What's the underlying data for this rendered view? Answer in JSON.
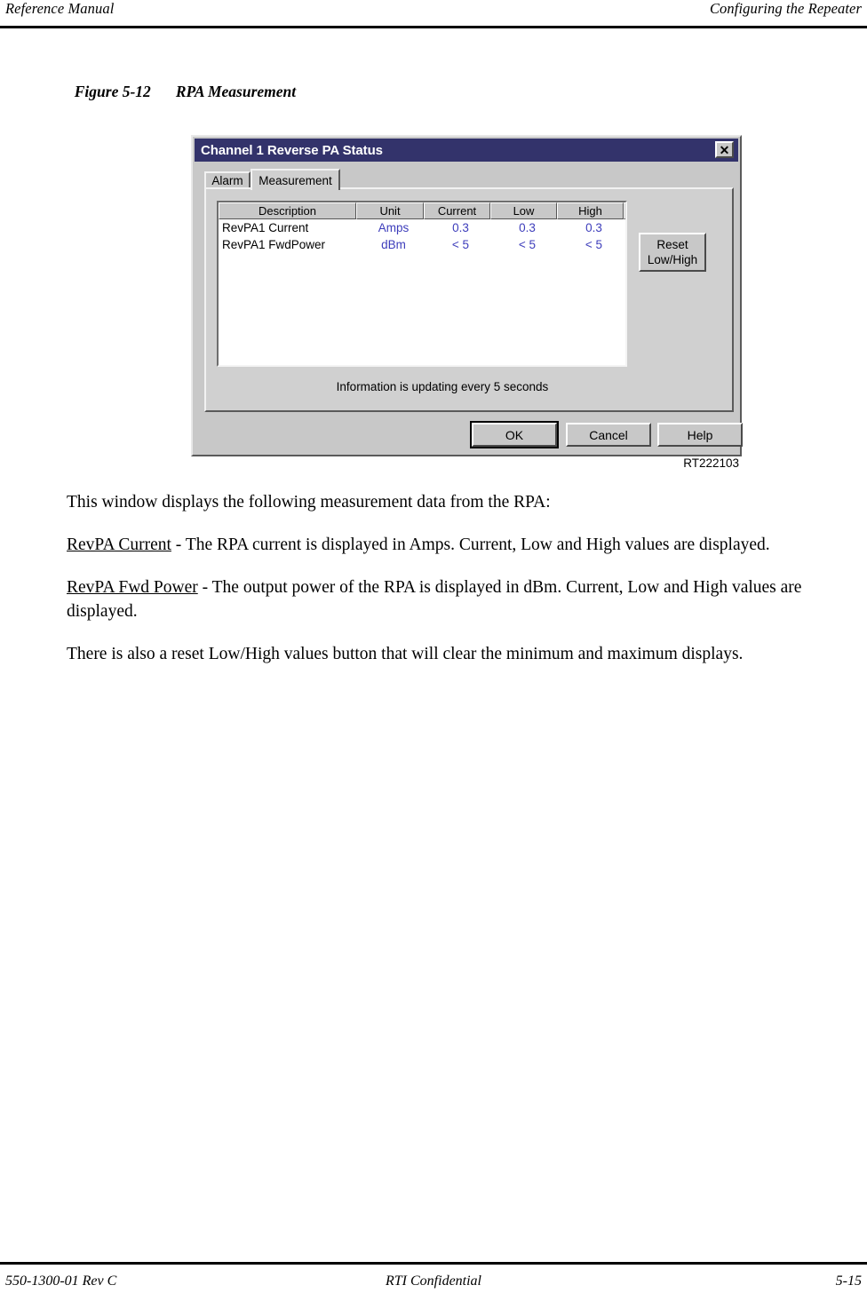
{
  "page": {
    "header_left": "Reference Manual",
    "header_right": "Configuring the Repeater",
    "footer_left": "550-1300-01 Rev C",
    "footer_center": "RTI Confidential",
    "footer_right": "5-15"
  },
  "figure": {
    "number": "Figure 5-12",
    "title": "RPA Measurement",
    "id_caption": "RT222103"
  },
  "dialog": {
    "title": "Channel 1 Reverse PA Status",
    "close_icon": "close-icon",
    "close_glyph": "✕",
    "titlebar_color": "#33336b",
    "value_color": "#3d3dbb",
    "face_color": "#c8c8c8",
    "tabs": [
      {
        "label": "Alarm",
        "active": false
      },
      {
        "label": "Measurement",
        "active": true
      }
    ],
    "table": {
      "columns": [
        "Description",
        "Unit",
        "Current",
        "Low",
        "High"
      ],
      "rows": [
        {
          "description": "RevPA1 Current",
          "unit": "Amps",
          "current": "0.3",
          "low": "0.3",
          "high": "0.3"
        },
        {
          "description": "RevPA1 FwdPower",
          "unit": "dBm",
          "current": "< 5",
          "low": "< 5",
          "high": "< 5"
        }
      ]
    },
    "reset_button": {
      "line1": "Reset",
      "line2": "Low/High"
    },
    "status_text": "Information is updating every 5 seconds",
    "buttons": [
      {
        "label": "OK",
        "default": true
      },
      {
        "label": "Cancel",
        "default": false
      },
      {
        "label": "Help",
        "default": false
      }
    ]
  },
  "body": {
    "intro": "This window displays the following measurement data from the RPA:",
    "para1_term": "RevPA Current",
    "para1_rest": " - The RPA current is displayed in Amps. Current, Low and High values are displayed.",
    "para2_term": "RevPA Fwd Power",
    "para2_rest": " - The output power of the RPA is displayed in dBm. Current, Low and High values are displayed.",
    "para3": "There is also a reset Low/High values button that will clear the minimum and maximum displays."
  }
}
